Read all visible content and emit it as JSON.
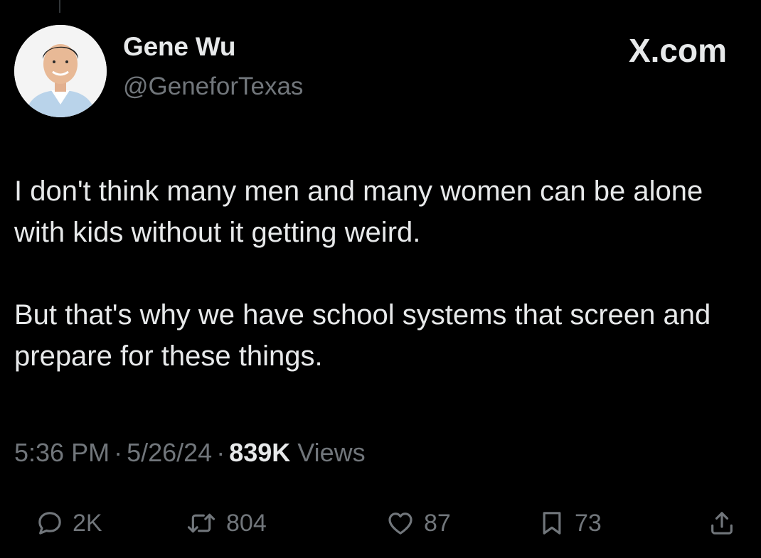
{
  "author": {
    "name": "Gene Wu",
    "handle": "@GeneforTexas"
  },
  "site_label": "X.com",
  "tweet": {
    "paragraphs": [
      "I don't think many men and many women can be alone with kids without it getting weird.",
      "But that's why we have school systems that screen and prepare for these things."
    ]
  },
  "meta": {
    "time": "5:36 PM",
    "separator": "·",
    "date": "5/26/24",
    "views_count": "839K",
    "views_label": "Views"
  },
  "actions": {
    "reply": {
      "icon": "reply-icon",
      "count": "2K"
    },
    "repost": {
      "icon": "repost-icon",
      "count": "804"
    },
    "like": {
      "icon": "heart-icon",
      "count": "87"
    },
    "bookmark": {
      "icon": "bookmark-icon",
      "count": "73"
    },
    "share": {
      "icon": "share-icon"
    }
  },
  "colors": {
    "background": "#000000",
    "primary_text": "#e7e9ea",
    "secondary_text": "#71767b"
  }
}
